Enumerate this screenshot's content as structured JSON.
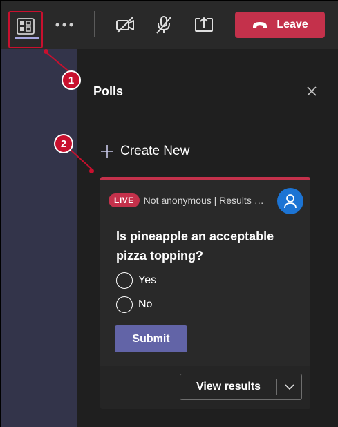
{
  "toolbar": {
    "apps_icon": "apps-panel-icon",
    "more_icon": "more-options-icon",
    "camera_icon": "camera-off-icon",
    "mic_icon": "mic-off-icon",
    "share_icon": "share-screen-icon",
    "leave_label": "Leave",
    "leave_icon": "phone-hangup-icon",
    "leave_color": "#c4314b"
  },
  "annotations": {
    "marker_1": "1",
    "marker_2": "2",
    "color": "#c8102e"
  },
  "panel": {
    "title": "Polls",
    "close_icon": "close-icon",
    "create_new_label": "Create New"
  },
  "poll": {
    "status_badge": "LIVE",
    "meta": "Not anonymous | Results shared",
    "question": "Is pineapple an acceptable pizza topping?",
    "options": [
      {
        "label": "Yes"
      },
      {
        "label": "No"
      }
    ],
    "submit_label": "Submit",
    "view_results_label": "View results",
    "accent_color": "#6264a7"
  }
}
